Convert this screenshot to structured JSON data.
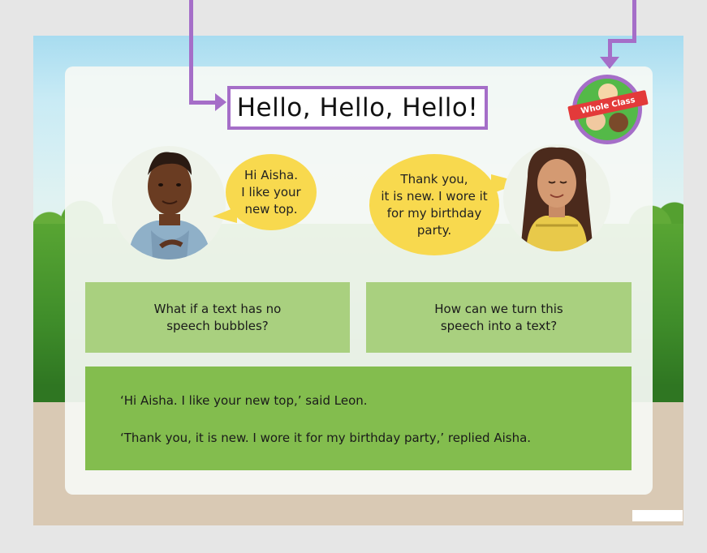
{
  "slide": {
    "title": "Hello, Hello, Hello!",
    "badge_label": "Whole Class"
  },
  "dialogue": {
    "leon_bubble": "Hi Aisha.\nI like your\nnew top.",
    "aisha_bubble": "Thank you,\nit is new. I wore it\nfor my birthday\nparty."
  },
  "questions": [
    "What if a text has no\nspeech bubbles?",
    "How can we turn this\nspeech into a text?"
  ],
  "text_version": [
    "‘Hi Aisha. I like your new top,’ said Leon.",
    "‘Thank you, it is new. I wore it for my birthday party,’ replied Aisha."
  ],
  "colors": {
    "annotation": "#a56ec8",
    "bubble": "#f8d94e",
    "question_box": "#a9d07f",
    "answer_box": "#83bd4e"
  },
  "icons": [
    "whole-class-badge-icon"
  ]
}
